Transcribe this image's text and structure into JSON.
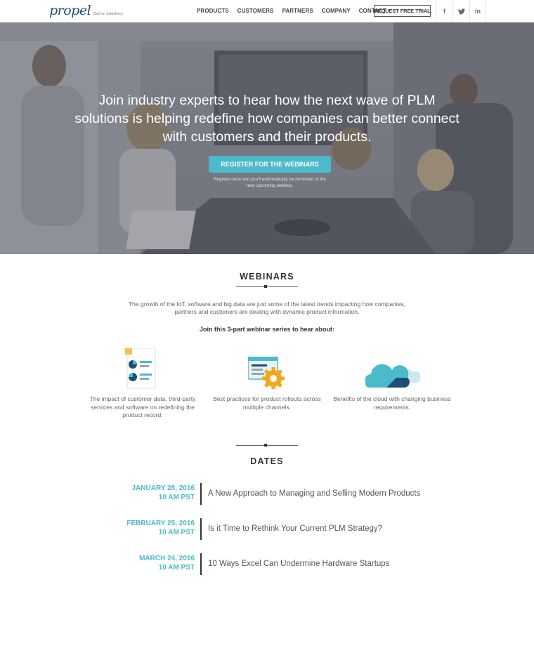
{
  "nav": {
    "logo_text": "propel",
    "logo_tagline": "Built on Salesforce",
    "links": [
      "PRODUCTS",
      "CUSTOMERS",
      "PARTNERS",
      "COMPANY",
      "CONTACT"
    ],
    "cta": "REQUEST FREE TRIAL",
    "social": [
      "f",
      "t",
      "in"
    ]
  },
  "hero": {
    "title": "Join industry experts to hear how the next wave of PLM solutions is helping redefine how companies can better connect with customers and their products.",
    "button": "REGISTER FOR THE WEBINARS",
    "subtext": "Register once and you'll automatically be reminded of the next upcoming webinar."
  },
  "webinars": {
    "title": "WEBINARS",
    "intro": "The growth of the IoT, software and big data are just some of the latest trends impacting how companies, partners and customers are dealing with dynamic product information.",
    "join": "Join this 3-part webinar series to hear about:",
    "features": [
      {
        "icon": "document-chart-icon",
        "text": "The impact of customer data, third-party services and software on redefining the product record."
      },
      {
        "icon": "browser-gear-icon",
        "text": "Best practices for product rollouts across multiple channels."
      },
      {
        "icon": "cloud-icon",
        "text": "Benefits of the cloud with changing business requirements."
      }
    ]
  },
  "dates": {
    "title": "DATES",
    "items": [
      {
        "date": "JANUARY 28, 2016",
        "time": "10 AM PST",
        "topic": "A New Approach to Managing and Selling Modern Products"
      },
      {
        "date": "FEBRUARY 25, 2016",
        "time": "10 AM PST",
        "topic": "Is it Time to Rethink Your Current PLM Strategy?"
      },
      {
        "date": "MARCH 24, 2016",
        "time": "10 AM PST",
        "topic": "10 Ways Excel Can Undermine Hardware Startups"
      }
    ]
  },
  "colors": {
    "accent": "#4bbacb",
    "logo": "#1d4e75",
    "text_dark": "#333333",
    "text_body": "#666666"
  }
}
